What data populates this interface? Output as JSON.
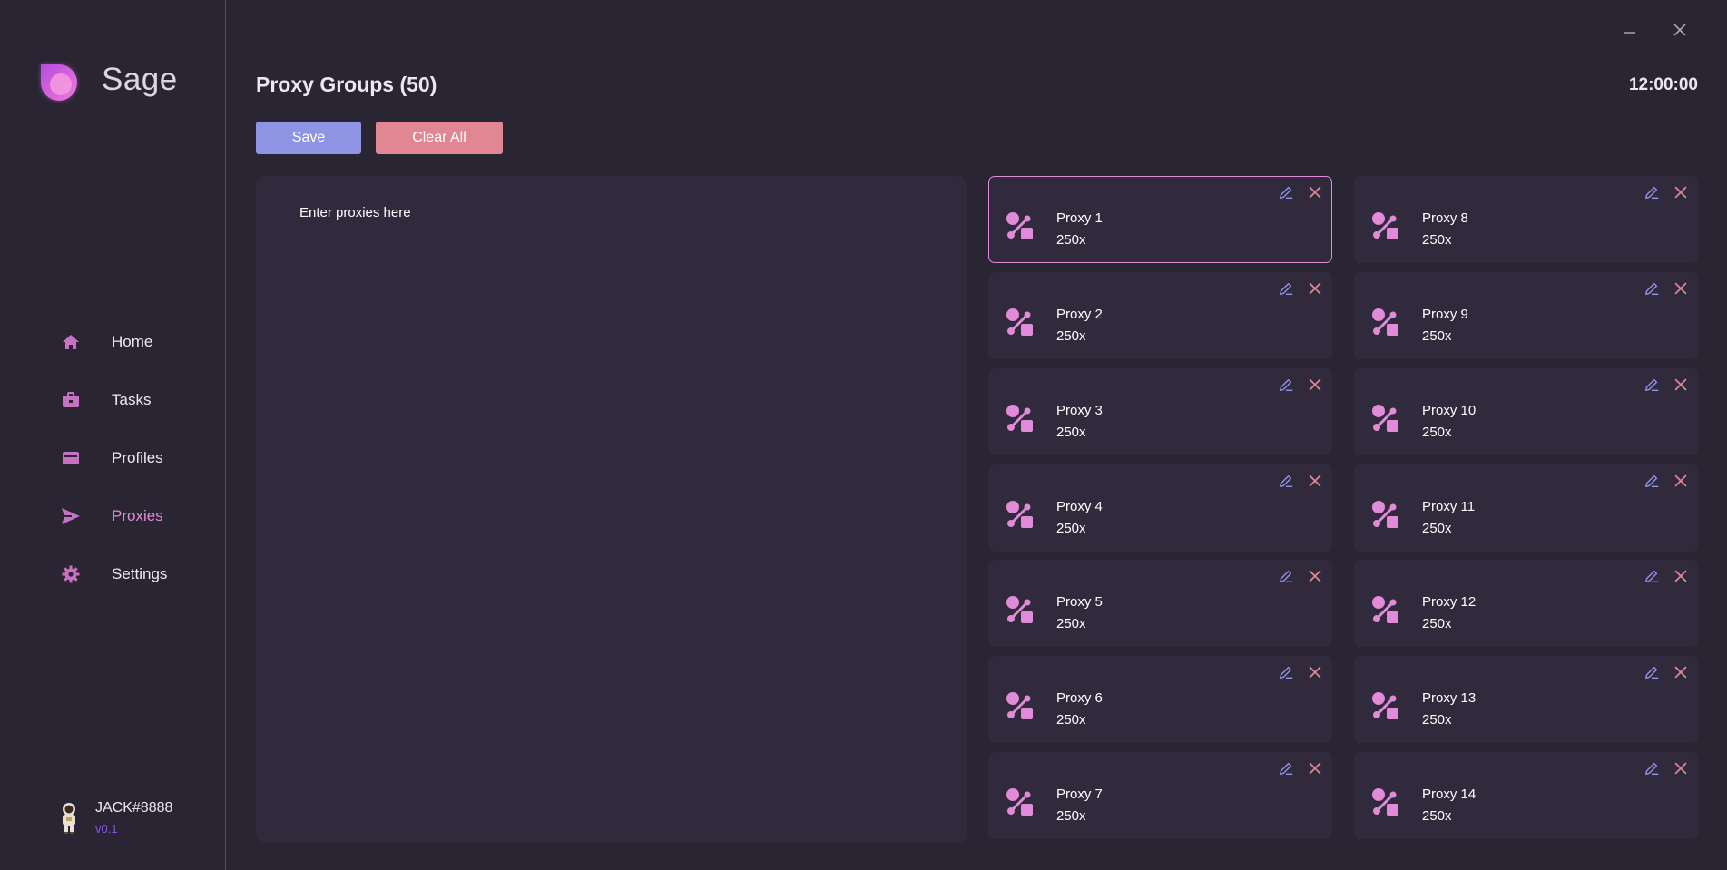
{
  "app": {
    "brand": "Sage"
  },
  "colors": {
    "background": "#2a2533",
    "panel": "#302a3c",
    "accent": "#e08bd7",
    "save": "#8e93e3",
    "clear": "#e18794",
    "version": "#8d4fe2"
  },
  "sidebar": {
    "items": [
      {
        "label": "Home",
        "icon": "home-icon",
        "active": false
      },
      {
        "label": "Tasks",
        "icon": "briefcase-icon",
        "active": false
      },
      {
        "label": "Profiles",
        "icon": "wallet-icon",
        "active": false
      },
      {
        "label": "Proxies",
        "icon": "paper-plane-icon",
        "active": true
      },
      {
        "label": "Settings",
        "icon": "gear-icon",
        "active": false
      }
    ],
    "user": {
      "name": "JACK#8888",
      "version": "v0.1"
    }
  },
  "header": {
    "title": "Proxy Groups (50)",
    "clock": "12:00:00"
  },
  "toolbar": {
    "save_label": "Save",
    "clear_label": "Clear All"
  },
  "editor": {
    "placeholder": "Enter proxies here",
    "value": ""
  },
  "proxies": [
    {
      "name": "Proxy 1",
      "count": "250x",
      "selected": true
    },
    {
      "name": "Proxy 2",
      "count": "250x"
    },
    {
      "name": "Proxy 3",
      "count": "250x"
    },
    {
      "name": "Proxy 4",
      "count": "250x"
    },
    {
      "name": "Proxy 5",
      "count": "250x"
    },
    {
      "name": "Proxy 6",
      "count": "250x"
    },
    {
      "name": "Proxy 7",
      "count": "250x"
    },
    {
      "name": "Proxy 8",
      "count": "250x"
    },
    {
      "name": "Proxy 9",
      "count": "250x"
    },
    {
      "name": "Proxy 10",
      "count": "250x"
    },
    {
      "name": "Proxy 11",
      "count": "250x"
    },
    {
      "name": "Proxy 12",
      "count": "250x"
    },
    {
      "name": "Proxy 13",
      "count": "250x"
    },
    {
      "name": "Proxy 14",
      "count": "250x"
    }
  ]
}
